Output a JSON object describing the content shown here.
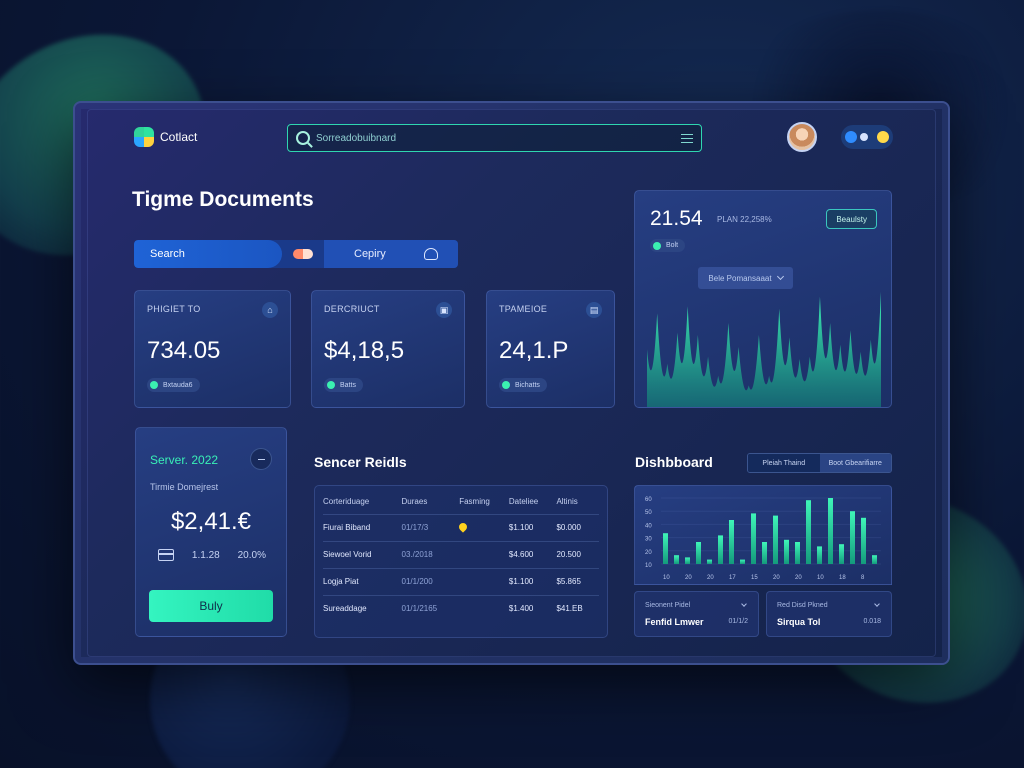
{
  "header": {
    "logo_text": "Cotlact",
    "search_value": "Sorreadobuibnard",
    "avatar_name": "user-avatar"
  },
  "page": {
    "title": "Tigme Documents"
  },
  "tabs": {
    "search_label": "Search",
    "category_label": "Cepiry"
  },
  "stats": [
    {
      "label": "PHIGIET TO",
      "value": "734.05",
      "badge": "Bxtauda6",
      "icon": "home-icon"
    },
    {
      "label": "DERCRIUCT",
      "value": "$4,18,5",
      "badge": "Batts",
      "icon": "box-icon"
    },
    {
      "label": "TPAMEIOE",
      "value": "24,1.P",
      "badge": "Bichatts",
      "icon": "file-icon"
    }
  ],
  "big_card": {
    "value": "21.54",
    "sub": "PLAN 22,258%",
    "button": "Beaulsty",
    "badge": "Bolt",
    "dropdown": "Bele Pomansaaat",
    "values": [
      48,
      78,
      36,
      62,
      84,
      60,
      42,
      26,
      70,
      50,
      18,
      60,
      26,
      82,
      58,
      40,
      42,
      92,
      70,
      52,
      64,
      46,
      56,
      96
    ]
  },
  "server_card": {
    "title": "Server. 2022",
    "sub": "Tirmie Domejrest",
    "value": "$2,41.€",
    "left_stat": "1.1.28",
    "right_stat": "20.0%",
    "buy_label": "Buly"
  },
  "table": {
    "title": "Sencer Reidls",
    "headers": [
      "Corteriduage",
      "Duraes",
      "Fasming",
      "Dateliee",
      "Altinis"
    ],
    "rows": [
      [
        "Fiurai Biband",
        "01/17/3",
        "pin",
        "$1.100",
        "$0.000"
      ],
      [
        "Siewoel Vorid",
        "03./2018",
        "",
        "$4.600",
        "20.500"
      ],
      [
        "Logja Piat",
        "01/1/200",
        "",
        "$1.100",
        "$5.865"
      ],
      [
        "Sureaddage",
        "01/1/2165",
        "",
        "$1.400",
        "$41.EB"
      ]
    ]
  },
  "dashboard": {
    "title": "Dishbboard",
    "segment_left": "Pleiah Thaind",
    "segment_right": "Boot Gbearifiarre",
    "y_ticks": [
      "60",
      "50",
      "40",
      "30",
      "20",
      "10"
    ],
    "x_ticks": [
      "10",
      "20",
      "20",
      "17",
      "15",
      "20",
      "20",
      "10",
      "18",
      "8"
    ],
    "values": [
      28,
      8,
      6,
      20,
      4,
      26,
      40,
      4,
      46,
      20,
      44,
      22,
      20,
      58,
      16,
      60,
      18,
      48,
      42,
      8
    ]
  },
  "mini_cards": [
    {
      "label": "Sieonent Pidel",
      "value": "Fenfid Lmwer",
      "value2": "01/1/2"
    },
    {
      "label": "Red Disd Pkned",
      "value": "Sirqua Tol",
      "value2": "0.018"
    }
  ],
  "colors": {
    "accent": "#34f4c0",
    "primary": "#1f63d6",
    "background": "#0b1736"
  }
}
